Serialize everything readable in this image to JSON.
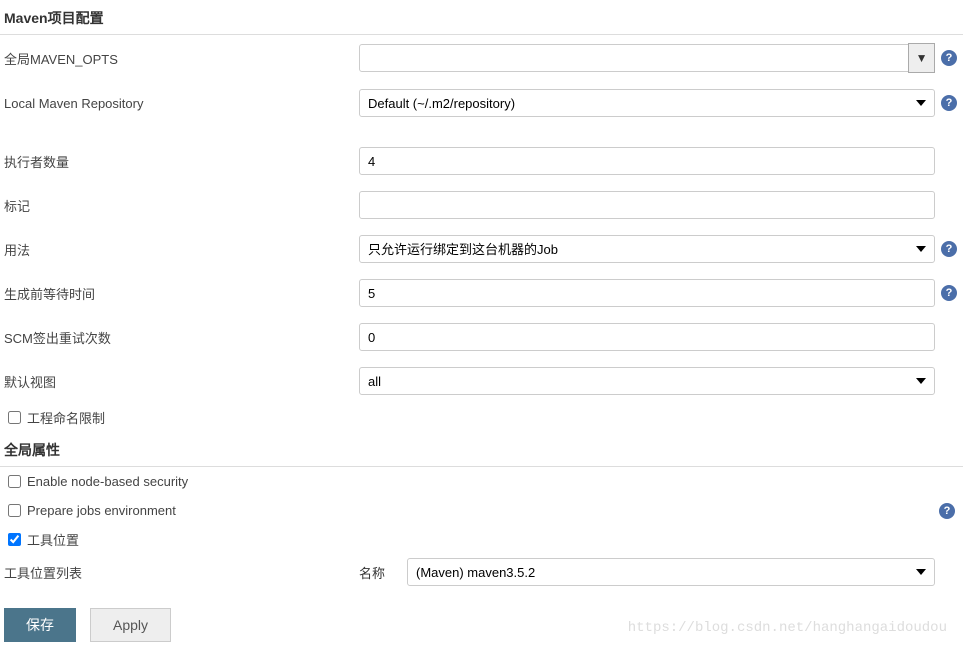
{
  "sections": {
    "maven_header": "Maven项目配置",
    "global_header": "全局属性"
  },
  "maven": {
    "global_opts_label": "全局MAVEN_OPTS",
    "global_opts_value": "",
    "local_repo_label": "Local Maven Repository",
    "local_repo_value": "Default (~/.m2/repository)"
  },
  "executors": {
    "count_label": "执行者数量",
    "count_value": "4",
    "labels_label": "标记",
    "labels_value": "",
    "usage_label": "用法",
    "usage_value": "只允许运行绑定到这台机器的Job",
    "quiet_label": "生成前等待时间",
    "quiet_value": "5",
    "scm_label": "SCM签出重试次数",
    "scm_value": "0",
    "view_label": "默认视图",
    "view_value": "all"
  },
  "checkboxes": {
    "naming_label": "工程命名限制",
    "naming_checked": false,
    "node_sec_label": "Enable node-based security",
    "node_sec_checked": false,
    "prep_env_label": "Prepare jobs environment",
    "prep_env_checked": false,
    "tool_loc_label": "工具位置",
    "tool_loc_checked": true
  },
  "tool": {
    "list_label": "工具位置列表",
    "name_label": "名称",
    "name_value": "(Maven) maven3.5.2"
  },
  "buttons": {
    "save": "保存",
    "apply": "Apply"
  },
  "watermark": "https://blog.csdn.net/hanghangaidoudou"
}
